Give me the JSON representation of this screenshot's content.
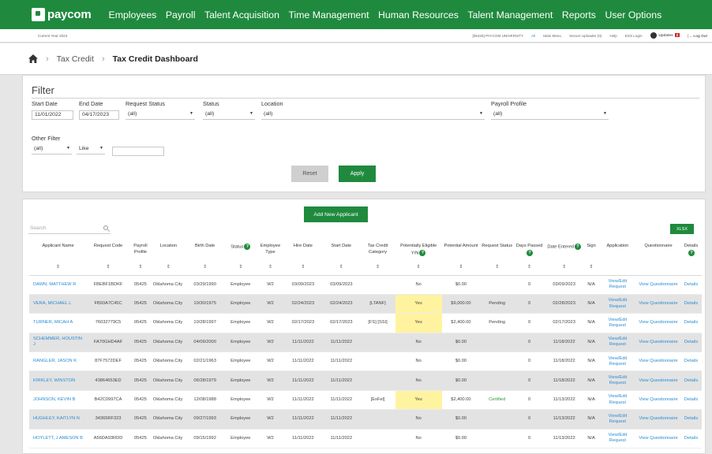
{
  "nav": {
    "logo": "paycom",
    "items": [
      "Employees",
      "Payroll",
      "Talent Acquisition",
      "Time Management",
      "Human Resources",
      "Talent Management",
      "Reports",
      "User Options"
    ]
  },
  "util": {
    "current_year": "Current Year 2023",
    "company": "[05425] PAYCOM UNIVERSITY",
    "all": "All",
    "main_menu": "Main Menu",
    "secure_uploader": "Secure Uploader (0)",
    "help": "Help",
    "ess_login": "ESS Login",
    "updates": "Updates",
    "updates_count": "2",
    "logout": "Log Out"
  },
  "breadcrumb": {
    "section": "Tax Credit",
    "current": "Tax Credit Dashboard"
  },
  "filter": {
    "title": "Filter",
    "start_date_label": "Start Date",
    "start_date": "11/01/2022",
    "end_date_label": "End Date",
    "end_date": "04/17/2023",
    "request_status_label": "Request Status",
    "request_status": "(all)",
    "status_label": "Status",
    "status": "(all)",
    "location_label": "Location",
    "location": "(all)",
    "payroll_profile_label": "Payroll Profile",
    "payroll_profile": "(all)",
    "other_filter_label": "Other Filter",
    "other_filter": "(all)",
    "operator": "Like",
    "other_value": "",
    "reset": "Reset",
    "apply": "Apply"
  },
  "applicants": {
    "add_button": "Add New Applicant",
    "search_placeholder": "Search",
    "xlsx": "XLSX",
    "columns": [
      "Applicant Name",
      "Request Code",
      "Payroll Profile",
      "Location",
      "Birth Date",
      "Status",
      "Employee Type",
      "Hire Date",
      "Start Date",
      "Tax Credit Category",
      "Potentially Eligible Y/N",
      "Potential Amount",
      "Request Status",
      "Days Passed",
      "Date Entered",
      "Sign",
      "Application",
      "Questionnaire",
      "Details"
    ],
    "rows": [
      [
        "DAWN, MATTHEW R",
        "FBEBF1BDKF",
        "05425",
        "Oklahoma City",
        "03/29/1990",
        "Employee",
        "W2",
        "03/09/2023",
        "03/09/2023",
        "",
        "No",
        "$0.00",
        "",
        "0",
        "03/09/2023",
        "N/A",
        "View/Edit Request",
        "View Questionnaire",
        "Details"
      ],
      [
        "VERA, MICHAEL L",
        "FB93A7C45C",
        "05425",
        "Oklahoma City",
        "10/30/1975",
        "Employee",
        "W2",
        "02/24/2023",
        "02/24/2023",
        "[LTANF]",
        "Yes",
        "$9,000.00",
        "Pending",
        "0",
        "02/28/2023",
        "N/A",
        "View/Edit Request",
        "View Questionnaire",
        "Details"
      ],
      [
        "TURNER, MICAH A",
        "76032779C5",
        "05425",
        "Oklahoma City",
        "10/28/1997",
        "Employee",
        "W2",
        "02/17/2023",
        "02/17/2023",
        "[FS] [SSI]",
        "Yes",
        "$2,400.00",
        "Pending",
        "0",
        "02/17/2023",
        "N/A",
        "View/Edit Request",
        "View Questionnaire",
        "Details"
      ],
      [
        "SCHEMMER, HOUSTIN J",
        "FA70GHD4AF",
        "05425",
        "Oklahoma City",
        "04/09/2000",
        "Employee",
        "W2",
        "11/11/2022",
        "11/11/2022",
        "",
        "No",
        "$0.00",
        "",
        "0",
        "11/18/2022",
        "N/A",
        "View/Edit Request",
        "View Questionnaire",
        "Details"
      ],
      [
        "RANGLER, JASON K",
        "87F7572DEF",
        "05425",
        "Oklahoma City",
        "02/21/1963",
        "Employee",
        "W2",
        "11/11/2022",
        "11/11/2022",
        "",
        "No",
        "$0.00",
        "",
        "0",
        "11/18/2022",
        "N/A",
        "View/Edit Request",
        "View Questionnaire",
        "Details"
      ],
      [
        "KIRKLEY, WINSTON",
        "43864653ED",
        "05425",
        "Oklahoma City",
        "06/28/1979",
        "Employee",
        "W2",
        "11/11/2022",
        "11/11/2022",
        "",
        "No",
        "$0.00",
        "",
        "0",
        "11/18/2022",
        "N/A",
        "View/Edit Request",
        "View Questionnaire",
        "Details"
      ],
      [
        "JOHNSON, KEVIN B",
        "B42C0997CA",
        "05425",
        "Oklahoma City",
        "12/08/1988",
        "Employee",
        "W2",
        "11/11/2022",
        "11/11/2022",
        "[ExFel]",
        "Yes",
        "$2,400.00",
        "Certified",
        "0",
        "11/13/2022",
        "N/A",
        "View/Edit Request",
        "View Questionnaire",
        "Details"
      ],
      [
        "HUGHLEY, KAITLYN N",
        "34365RF323",
        "05425",
        "Oklahoma City",
        "09/27/1993",
        "Employee",
        "W2",
        "11/11/2022",
        "11/11/2022",
        "",
        "No",
        "$0.00",
        "",
        "0",
        "11/13/2022",
        "N/A",
        "View/Edit Request",
        "View Questionnaire",
        "Details"
      ],
      [
        "HOYLETT, J AMESON B",
        "A56DA93RDD",
        "05425",
        "Oklahoma City",
        "09/15/1992",
        "Employee",
        "W2",
        "11/11/2022",
        "11/11/2022",
        "",
        "No",
        "$0.00",
        "",
        "0",
        "11/13/2022",
        "N/A",
        "View/Edit Request",
        "View Questionnaire",
        "Details"
      ]
    ]
  },
  "colors": {
    "brand_green": "#1f8a3e",
    "link_blue": "#2a8cd4",
    "highlight_yellow": "#fff3a0",
    "alert_red": "#d0262a"
  }
}
